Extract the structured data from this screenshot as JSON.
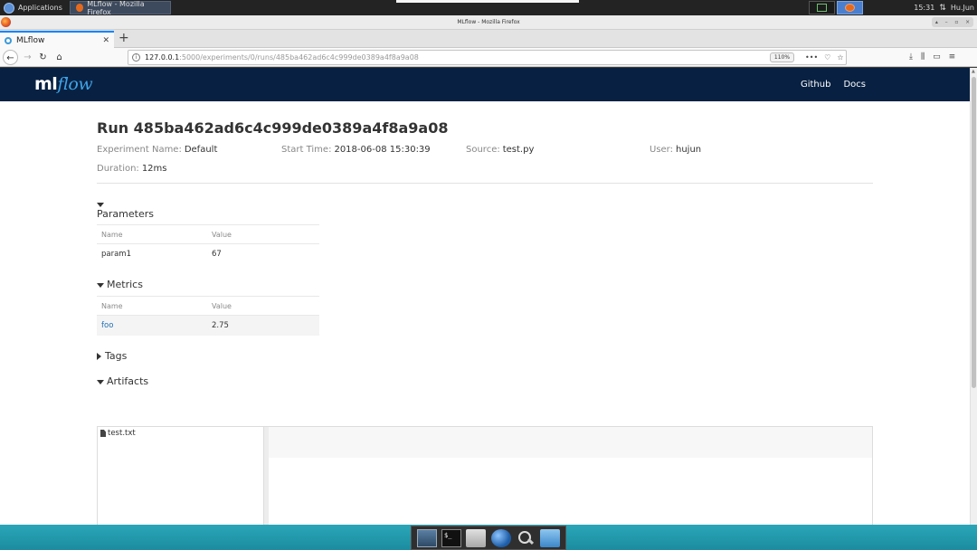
{
  "system": {
    "applications_label": "Applications",
    "task_label": "MLflow - Mozilla Firefox",
    "clock": "15:31",
    "user": "Hu.Jun"
  },
  "window": {
    "title": "MLflow - Mozilla Firefox"
  },
  "browser": {
    "tab_label": "MLflow",
    "url_host": "127.0.0.1",
    "url_path": ":5000/experiments/0/runs/485ba462ad6c4c999de0389a4f8a9a08",
    "zoom": "110%"
  },
  "mlflow": {
    "logo_ml": "ml",
    "logo_flow": "flow",
    "nav": {
      "github": "Github",
      "docs": "Docs"
    },
    "run_title": "Run 485ba462ad6c4c999de0389a4f8a9a08",
    "meta": {
      "experiment_label": "Experiment Name:",
      "experiment_value": "Default",
      "start_label": "Start Time:",
      "start_value": "2018-06-08 15:30:39",
      "source_label": "Source:",
      "source_value": "test.py",
      "user_label": "User:",
      "user_value": "hujun",
      "duration_label": "Duration:",
      "duration_value": "12ms"
    },
    "parameters": {
      "heading": "Parameters",
      "col_name": "Name",
      "col_value": "Value",
      "rows": [
        {
          "name": "param1",
          "value": "67"
        }
      ]
    },
    "metrics": {
      "heading": "Metrics",
      "col_name": "Name",
      "col_value": "Value",
      "rows": [
        {
          "name": "foo",
          "value": "2.75"
        }
      ]
    },
    "tags": {
      "heading": "Tags"
    },
    "artifacts": {
      "heading": "Artifacts",
      "files": [
        "test.txt"
      ]
    }
  }
}
